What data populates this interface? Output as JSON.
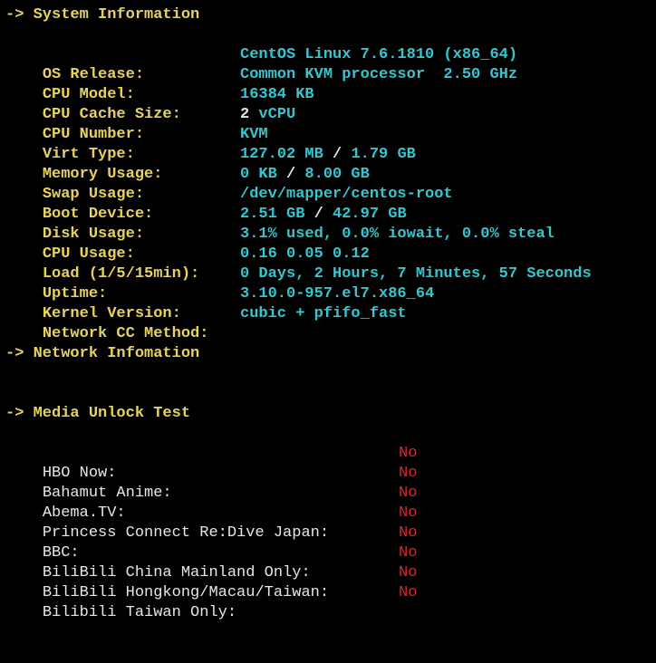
{
  "sections": {
    "system": "-> System Information",
    "network": "-> Network Infomation",
    "media": "-> Media Unlock Test"
  },
  "system": [
    {
      "label": "OS Release:",
      "value": "CentOS Linux 7.6.1810 (x86_64)"
    },
    {
      "label": "CPU Model:",
      "value": "Common KVM processor  2.50 GHz"
    },
    {
      "label": "CPU Cache Size:",
      "value": "16384 KB"
    },
    {
      "label": "CPU Number:",
      "value_a": "2",
      "value_b": " vCPU"
    },
    {
      "label": "Virt Type:",
      "value": "KVM"
    },
    {
      "label": "Memory Usage:",
      "value_a": "127.02 MB",
      "sep": " / ",
      "value_b": "1.79 GB"
    },
    {
      "label": "Swap Usage:",
      "value_a": "0 KB",
      "sep": " / ",
      "value_b": "8.00 GB"
    },
    {
      "label": "Boot Device:",
      "value": "/dev/mapper/centos-root"
    },
    {
      "label": "Disk Usage:",
      "value_a": "2.51 GB",
      "sep": " / ",
      "value_b": "42.97 GB"
    },
    {
      "label": "CPU Usage:",
      "value": "3.1% used, 0.0% iowait, 0.0% steal"
    },
    {
      "label": "Load (1/5/15min):",
      "value": "0.16 0.05 0.12"
    },
    {
      "label": "Uptime:",
      "value": "0 Days, 2 Hours, 7 Minutes, 57 Seconds"
    },
    {
      "label": "Kernel Version:",
      "value": "3.10.0-957.el7.x86_64"
    },
    {
      "label": "Network CC Method:",
      "value": "cubic + pfifo_fast"
    }
  ],
  "media": [
    {
      "service": "HBO Now:",
      "result": "No"
    },
    {
      "service": "Bahamut Anime:",
      "result": "No"
    },
    {
      "service": "Abema.TV:",
      "result": "No"
    },
    {
      "service": "Princess Connect Re:Dive Japan:",
      "result": "No"
    },
    {
      "service": "BBC:",
      "result": "No"
    },
    {
      "service": "BiliBili China Mainland Only:",
      "result": "No"
    },
    {
      "service": "BiliBili Hongkong/Macau/Taiwan:",
      "result": "No"
    },
    {
      "service": "Bilibili Taiwan Only:",
      "result": "No"
    }
  ]
}
